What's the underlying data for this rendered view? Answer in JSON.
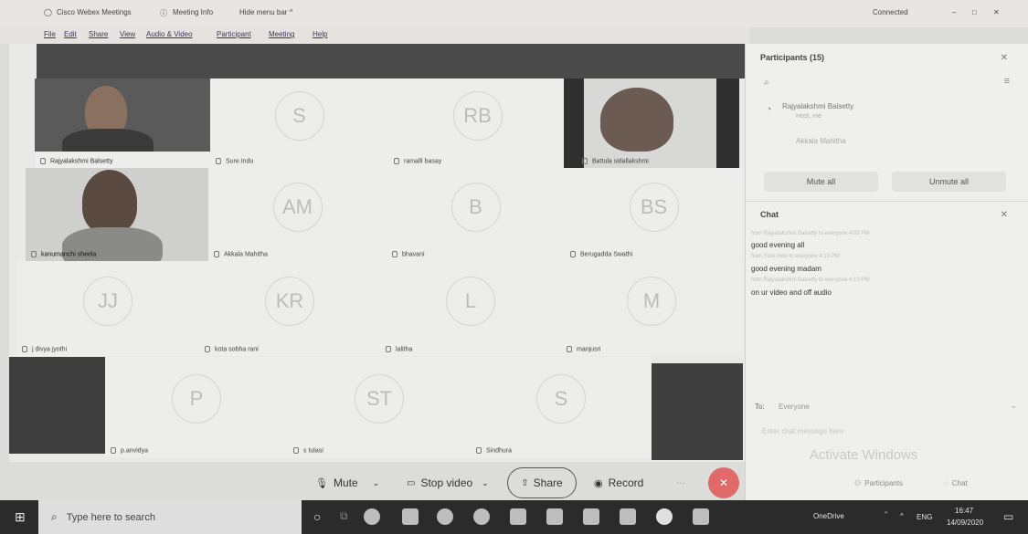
{
  "titlebar": {
    "app_name": "Cisco Webex Meetings",
    "meeting_info": "Meeting Info",
    "hide_menu": "Hide menu bar ^",
    "status": "Connected",
    "win_controls": [
      "–",
      "□",
      "✕"
    ]
  },
  "menu": [
    "File",
    "Edit",
    "Share",
    "View",
    "Audio & Video",
    "Participant",
    "Meeting",
    "Help"
  ],
  "tiles": [
    {
      "name": "Rajyalakshmi Balsetty",
      "video": true
    },
    {
      "name": "Sure.Indu",
      "initials": "S"
    },
    {
      "name": "ramalli basay",
      "initials": "RB"
    },
    {
      "name": "Battula sidallakshmi",
      "video": true
    },
    {
      "name": "kanumanchi sheela",
      "video": true
    },
    {
      "name": "Akkala Mahitha",
      "initials": "AM"
    },
    {
      "name": "bhavani",
      "initials": "B"
    },
    {
      "name": "Berugadda Swathi",
      "initials": "BS"
    },
    {
      "name": "j divya jyothi",
      "initials": "JJ"
    },
    {
      "name": "kota sobha rani",
      "initials": "KR"
    },
    {
      "name": "lalitha",
      "initials": "L"
    },
    {
      "name": "manjusri",
      "initials": "M"
    },
    {
      "name": "p.anvidya",
      "initials": "P"
    },
    {
      "name": "s tulasi",
      "initials": "ST"
    },
    {
      "name": "Sindhura",
      "initials": "S"
    }
  ],
  "participants_panel": {
    "title": "Participants (15)",
    "entries": [
      {
        "name": "Rajyalakshmi Balsetty",
        "role": "Host, me"
      },
      {
        "name": "Akkala Mahitha"
      }
    ],
    "mute_all": "Mute all",
    "unmute_all": "Unmute all"
  },
  "chat_panel": {
    "title": "Chat",
    "messages": [
      {
        "meta": "from Rajyalakshmi Balsetty to everyone 4:09 PM",
        "text": "good evening all"
      },
      {
        "meta": "from Sure.Indu to everyone 4:10 PM",
        "text": "good evening madam"
      },
      {
        "meta": "from Rajyalakshmi Balsetty to everyone 4:10 PM",
        "text": "on ur video and off audio"
      }
    ],
    "to_label": "To:",
    "to_value": "Everyone",
    "input_placeholder": "Enter chat message here"
  },
  "controls": {
    "mute": "Mute",
    "stop_video": "Stop video",
    "share": "Share",
    "record": "Record",
    "more": "···",
    "end": "✕",
    "participants_btn": "Participants",
    "chat_btn": "Chat"
  },
  "watermark": "Activate Windows",
  "taskbar": {
    "search_placeholder": "Type here to search",
    "onedrive": "OneDrive",
    "lang": "ENG",
    "time": "16:47",
    "date": "14/09/2020"
  },
  "colors": {
    "end_button": "#e06a6a",
    "taskbar": "#2b2b2b",
    "video_dark": "#3f3f3f"
  }
}
